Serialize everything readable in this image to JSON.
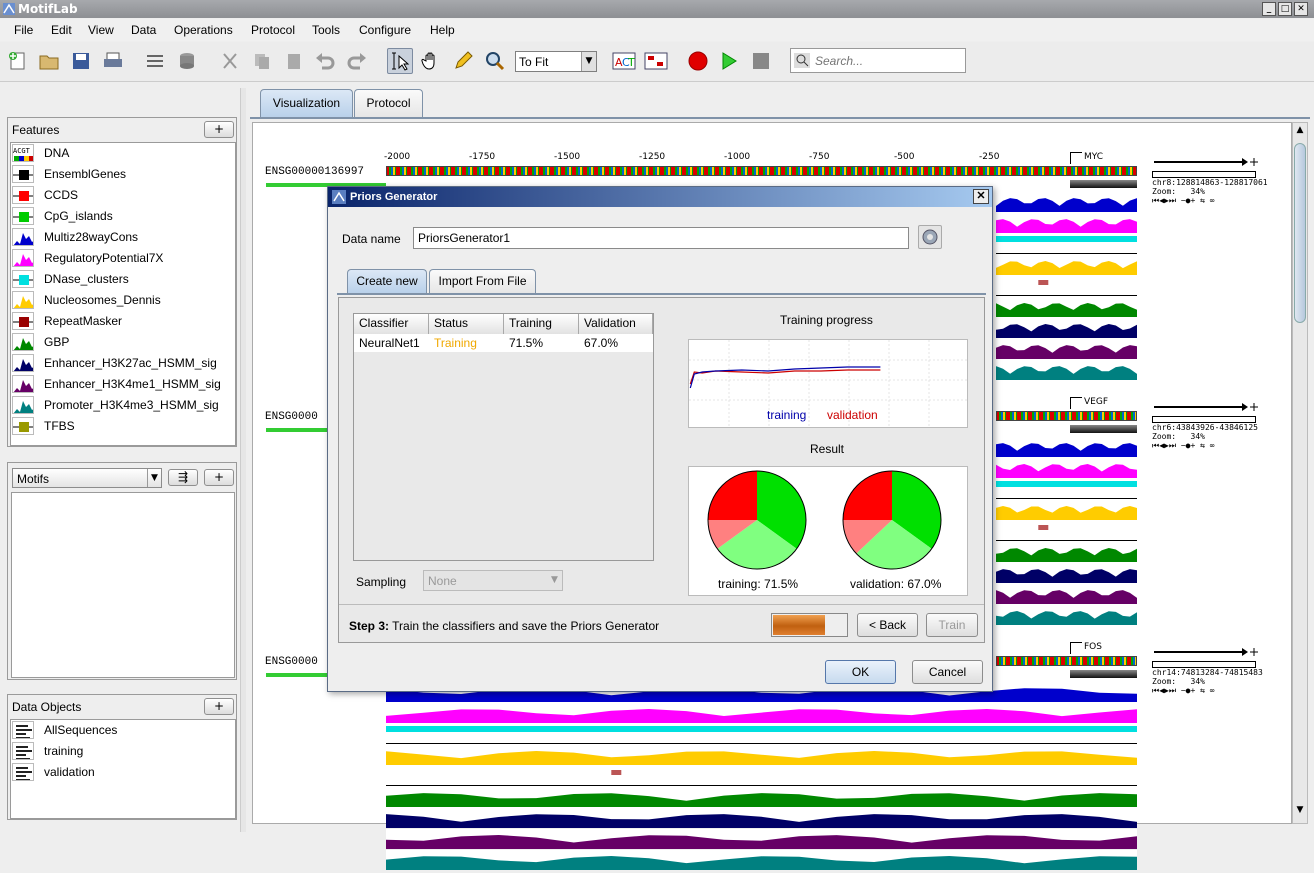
{
  "window": {
    "title": "MotifLab"
  },
  "menu": [
    "File",
    "Edit",
    "View",
    "Data",
    "Operations",
    "Protocol",
    "Tools",
    "Configure",
    "Help"
  ],
  "toolbar": {
    "zoom_value": "To Fit",
    "search_placeholder": "Search..."
  },
  "features_panel": {
    "title": "Features",
    "add_label": "+",
    "items": [
      {
        "label": "DNA",
        "icon": "dna-track-icon",
        "color": "#000000"
      },
      {
        "label": "EnsemblGenes",
        "icon": "region-track-icon",
        "color": "#000000"
      },
      {
        "label": "CCDS",
        "icon": "region-track-icon",
        "color": "#ff0000"
      },
      {
        "label": "CpG_islands",
        "icon": "region-track-icon",
        "color": "#00cc00"
      },
      {
        "label": "Multiz28wayCons",
        "icon": "numeric-track-icon",
        "color": "#0000cc"
      },
      {
        "label": "RegulatoryPotential7X",
        "icon": "numeric-track-icon",
        "color": "#ff00ff"
      },
      {
        "label": "DNase_clusters",
        "icon": "region-track-icon",
        "color": "#00e0e0"
      },
      {
        "label": "Nucleosomes_Dennis",
        "icon": "numeric-track-icon",
        "color": "#ffcc00"
      },
      {
        "label": "RepeatMasker",
        "icon": "region-track-icon",
        "color": "#990000"
      },
      {
        "label": "GBP",
        "icon": "numeric-track-icon",
        "color": "#008800"
      },
      {
        "label": "Enhancer_H3K27ac_HSMM_sig",
        "icon": "numeric-track-icon",
        "color": "#000066"
      },
      {
        "label": "Enhancer_H3K4me1_HSMM_sig",
        "icon": "numeric-track-icon",
        "color": "#660066"
      },
      {
        "label": "Promoter_H3K4me3_HSMM_sig",
        "icon": "numeric-track-icon",
        "color": "#008080"
      },
      {
        "label": "TFBS",
        "icon": "region-track-icon",
        "color": "#999900"
      }
    ]
  },
  "motifs_panel": {
    "selector": "Motifs",
    "add_label": "+",
    "tree_label": "⇶"
  },
  "data_objects_panel": {
    "title": "Data Objects",
    "add_label": "+",
    "items": [
      {
        "label": "AllSequences"
      },
      {
        "label": "training"
      },
      {
        "label": "validation"
      }
    ]
  },
  "main_tabs": [
    {
      "label": "Visualization",
      "active": true
    },
    {
      "label": "Protocol",
      "active": false
    }
  ],
  "ruler": {
    "ticks": [
      "-2000",
      "-1750",
      "-1500",
      "-1250",
      "-1000",
      "-750",
      "-500",
      "-250"
    ]
  },
  "sequences": [
    {
      "name": "ENSG00000136997",
      "gene": "MYC",
      "coords": "chr8:128814863-128817061",
      "zoom": "34%"
    },
    {
      "name": "ENSG0000",
      "gene": "VEGF",
      "coords": "chr6:43843926-43846125",
      "zoom": "34%"
    },
    {
      "name": "ENSG0000",
      "gene": "FOS",
      "coords": "chr14:74813284-74815483",
      "zoom": "34%"
    }
  ],
  "seq_controls": {
    "zoom_label": "Zoom:"
  },
  "dialog": {
    "title": "Priors Generator",
    "data_name_label": "Data name",
    "data_name_value": "PriorsGenerator1",
    "tabs": [
      {
        "label": "Create new",
        "active": true
      },
      {
        "label": "Import From File",
        "active": false
      }
    ],
    "table": {
      "headers": [
        "Classifier",
        "Status",
        "Training",
        "Validation"
      ],
      "rows": [
        {
          "classifier": "NeuralNet1",
          "status": "Training",
          "training": "71.5%",
          "validation": "67.0%"
        }
      ]
    },
    "sampling_label": "Sampling",
    "sampling_value": "None",
    "training_progress_title": "Training progress",
    "legend_training": "training",
    "legend_validation": "validation",
    "result_title": "Result",
    "pie_training_label": "training: 71.5%",
    "pie_validation_label": "validation: 67.0%",
    "step_bold": "Step 3:",
    "step_text": " Train the classifiers and save the Priors Generator",
    "back_label": "< Back",
    "train_label": "Train",
    "ok_label": "OK",
    "cancel_label": "Cancel",
    "colors": {
      "training_line": "#0000aa",
      "validation_line": "#cc0000",
      "status_training": "#f0a800"
    }
  }
}
